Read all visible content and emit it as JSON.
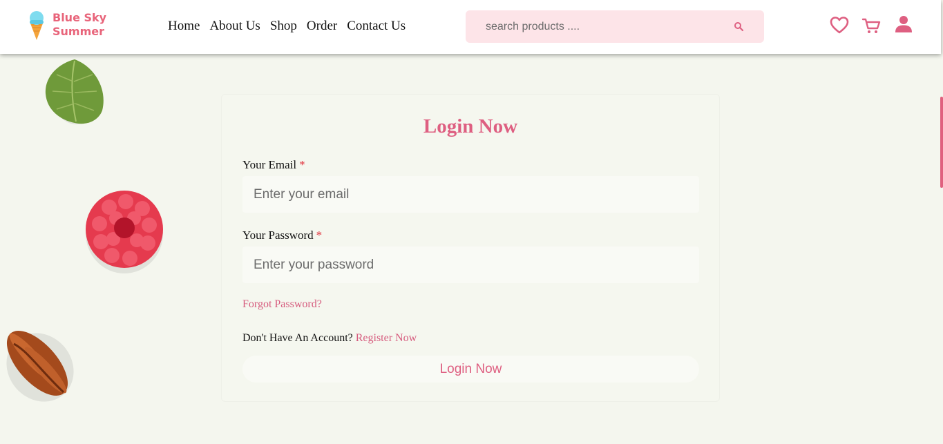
{
  "brand": {
    "line1": "Blue Sky",
    "line2": "Summer"
  },
  "nav": {
    "home": "Home",
    "about": "About Us",
    "shop": "Shop",
    "order": "Order",
    "contact": "Contact Us"
  },
  "search": {
    "placeholder": "search products ....",
    "value": ""
  },
  "icons": {
    "search": "search-icon",
    "wishlist": "heart-icon",
    "cart": "cart-icon",
    "account": "user-icon"
  },
  "colors": {
    "accent": "#de5f81",
    "brand": "#e8647a",
    "search_bg": "#fde4e8",
    "page_bg": "#f4f6ee",
    "required": "#e0303a"
  },
  "form": {
    "title": "Login Now",
    "email_label": "Your Email",
    "email_placeholder": "Enter your email",
    "password_label": "Your Password",
    "password_placeholder": "Enter your password",
    "required_mark": "*",
    "forgot": "Forgot Password?",
    "no_account": "Don't Have An Account?",
    "register": "Register Now",
    "submit": "Login Now"
  }
}
